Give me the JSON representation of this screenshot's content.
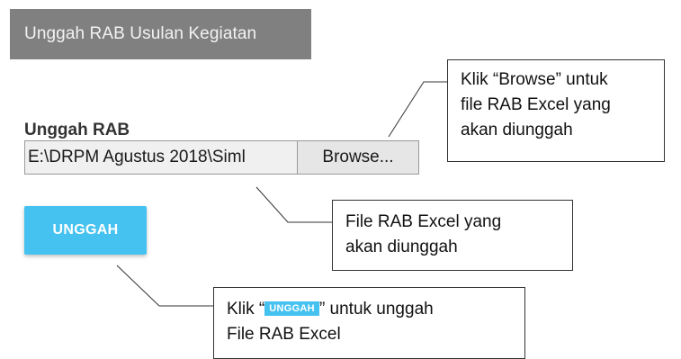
{
  "header": {
    "title": "Unggah RAB Usulan Kegiatan"
  },
  "form": {
    "label": "Unggah RAB",
    "file_path": "E:\\DRPM Agustus 2018\\Siml",
    "browse_label": "Browse...",
    "upload_label": "UNGGAH"
  },
  "callouts": {
    "browse": {
      "line1": "Klik “Browse” untuk",
      "line2": "file RAB Excel yang",
      "line3": "akan diunggah"
    },
    "file": {
      "line1": "File RAB Excel yang",
      "line2": "akan diunggah"
    },
    "upload": {
      "prefix": "Klik “",
      "badge": "UNGGAH",
      "suffix": "” untuk unggah",
      "line2": "File RAB Excel"
    }
  },
  "colors": {
    "header_bg": "#808080",
    "button_blue": "#45c2f0"
  }
}
